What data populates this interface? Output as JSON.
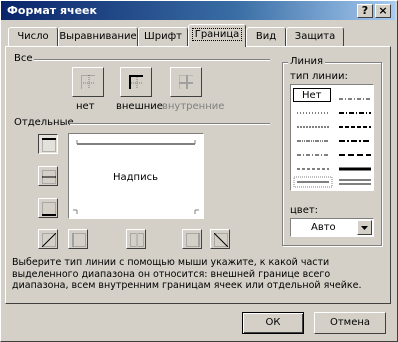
{
  "window": {
    "title": "Формат ячеек",
    "help_btn": "?",
    "close_btn": "×"
  },
  "tabs": [
    {
      "label": "Число"
    },
    {
      "label": "Выравнивание"
    },
    {
      "label": "Шрифт"
    },
    {
      "label": "Граница",
      "active": true
    },
    {
      "label": "Вид"
    },
    {
      "label": "Защита"
    }
  ],
  "border_tab": {
    "all_label": "Все",
    "presets": [
      {
        "label": "нет",
        "disabled": false
      },
      {
        "label": "внешние",
        "disabled": false
      },
      {
        "label": "внутренние",
        "disabled": true
      }
    ],
    "separate_label": "Отдельные",
    "preview_text": "Надпись",
    "line_group_label": "Линия",
    "line_type_label": "тип линии:",
    "line_none_label": "Нет",
    "color_label": "цвет:",
    "color_value": "Авто",
    "help_text": "Выберите тип линии с помощью мыши укажите, к какой части выделенного диапазона он относится: внешней границе всего диапазона, всем внутренним границам ячеек или отдельной ячейке."
  },
  "buttons": {
    "ok": "ОК",
    "cancel": "Отмена"
  }
}
